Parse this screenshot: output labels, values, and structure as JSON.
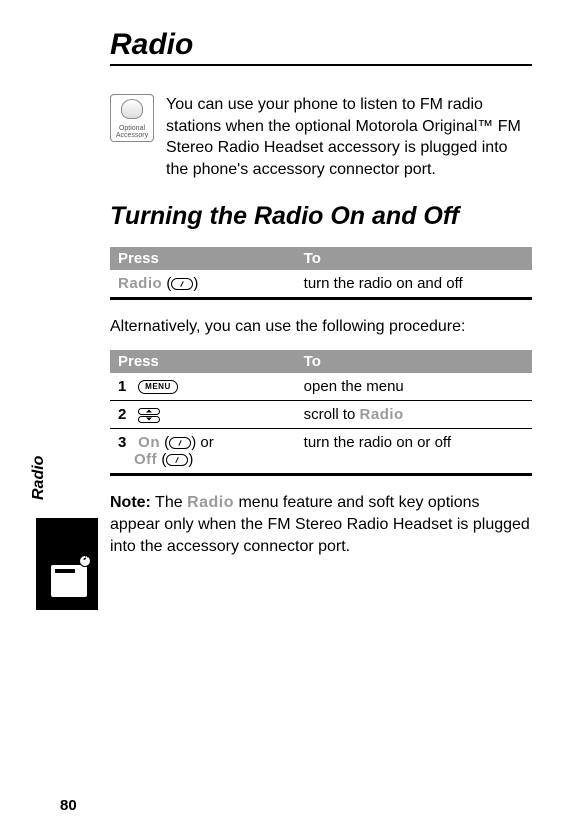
{
  "page_number": "80",
  "side_tab_label": "Radio",
  "main_title": "Radio",
  "accessory_badge": {
    "line1": "Optional",
    "line2": "Accessory"
  },
  "intro": "You can use your phone to listen to FM radio stations when the optional Motorola Original™ FM Stereo Radio Headset accessory is plugged into the phone's accessory connector port.",
  "section_title": "Turning the Radio On and Off",
  "table1": {
    "header": {
      "press": "Press",
      "to": "To"
    },
    "row": {
      "press_label": "Radio",
      "press_suffix_open": " (",
      "press_suffix_close": ")",
      "to": "turn the radio on and off"
    }
  },
  "alt_text": "Alternatively, you can use the following procedure:",
  "table2": {
    "header": {
      "press": "Press",
      "to": "To"
    },
    "rows": [
      {
        "num": "1",
        "menu_btn": "MENU",
        "to": "open the menu"
      },
      {
        "num": "2",
        "to_prefix": "scroll to ",
        "to_label": "Radio"
      },
      {
        "num": "3",
        "press_on": "On",
        "press_or": " or",
        "press_off": "Off",
        "paren_open": " (",
        "paren_close": ")",
        "to": "turn the radio on or off"
      }
    ]
  },
  "note": {
    "label": "Note:",
    "before": " The ",
    "menu_word": "Radio",
    "after": " menu feature and soft key options appear only when the FM Stereo Radio Headset is plugged into the accessory connector port."
  }
}
